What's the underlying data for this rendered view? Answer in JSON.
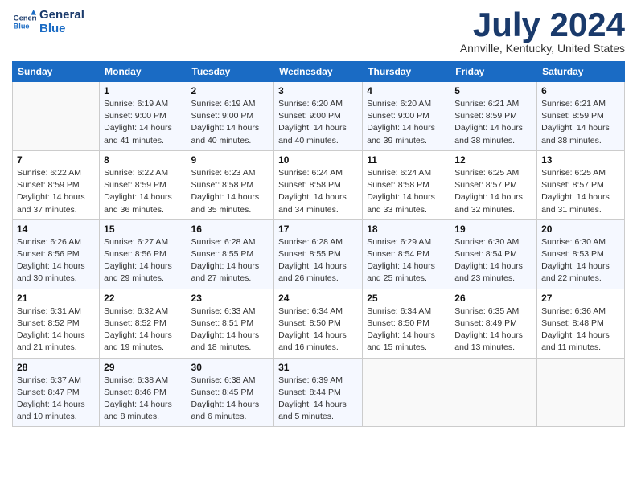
{
  "logo": {
    "line1": "General",
    "line2": "Blue"
  },
  "title": "July 2024",
  "subtitle": "Annville, Kentucky, United States",
  "days_of_week": [
    "Sunday",
    "Monday",
    "Tuesday",
    "Wednesday",
    "Thursday",
    "Friday",
    "Saturday"
  ],
  "weeks": [
    [
      {
        "day": "",
        "info": ""
      },
      {
        "day": "1",
        "info": "Sunrise: 6:19 AM\nSunset: 9:00 PM\nDaylight: 14 hours\nand 41 minutes."
      },
      {
        "day": "2",
        "info": "Sunrise: 6:19 AM\nSunset: 9:00 PM\nDaylight: 14 hours\nand 40 minutes."
      },
      {
        "day": "3",
        "info": "Sunrise: 6:20 AM\nSunset: 9:00 PM\nDaylight: 14 hours\nand 40 minutes."
      },
      {
        "day": "4",
        "info": "Sunrise: 6:20 AM\nSunset: 9:00 PM\nDaylight: 14 hours\nand 39 minutes."
      },
      {
        "day": "5",
        "info": "Sunrise: 6:21 AM\nSunset: 8:59 PM\nDaylight: 14 hours\nand 38 minutes."
      },
      {
        "day": "6",
        "info": "Sunrise: 6:21 AM\nSunset: 8:59 PM\nDaylight: 14 hours\nand 38 minutes."
      }
    ],
    [
      {
        "day": "7",
        "info": "Sunrise: 6:22 AM\nSunset: 8:59 PM\nDaylight: 14 hours\nand 37 minutes."
      },
      {
        "day": "8",
        "info": "Sunrise: 6:22 AM\nSunset: 8:59 PM\nDaylight: 14 hours\nand 36 minutes."
      },
      {
        "day": "9",
        "info": "Sunrise: 6:23 AM\nSunset: 8:58 PM\nDaylight: 14 hours\nand 35 minutes."
      },
      {
        "day": "10",
        "info": "Sunrise: 6:24 AM\nSunset: 8:58 PM\nDaylight: 14 hours\nand 34 minutes."
      },
      {
        "day": "11",
        "info": "Sunrise: 6:24 AM\nSunset: 8:58 PM\nDaylight: 14 hours\nand 33 minutes."
      },
      {
        "day": "12",
        "info": "Sunrise: 6:25 AM\nSunset: 8:57 PM\nDaylight: 14 hours\nand 32 minutes."
      },
      {
        "day": "13",
        "info": "Sunrise: 6:25 AM\nSunset: 8:57 PM\nDaylight: 14 hours\nand 31 minutes."
      }
    ],
    [
      {
        "day": "14",
        "info": "Sunrise: 6:26 AM\nSunset: 8:56 PM\nDaylight: 14 hours\nand 30 minutes."
      },
      {
        "day": "15",
        "info": "Sunrise: 6:27 AM\nSunset: 8:56 PM\nDaylight: 14 hours\nand 29 minutes."
      },
      {
        "day": "16",
        "info": "Sunrise: 6:28 AM\nSunset: 8:55 PM\nDaylight: 14 hours\nand 27 minutes."
      },
      {
        "day": "17",
        "info": "Sunrise: 6:28 AM\nSunset: 8:55 PM\nDaylight: 14 hours\nand 26 minutes."
      },
      {
        "day": "18",
        "info": "Sunrise: 6:29 AM\nSunset: 8:54 PM\nDaylight: 14 hours\nand 25 minutes."
      },
      {
        "day": "19",
        "info": "Sunrise: 6:30 AM\nSunset: 8:54 PM\nDaylight: 14 hours\nand 23 minutes."
      },
      {
        "day": "20",
        "info": "Sunrise: 6:30 AM\nSunset: 8:53 PM\nDaylight: 14 hours\nand 22 minutes."
      }
    ],
    [
      {
        "day": "21",
        "info": "Sunrise: 6:31 AM\nSunset: 8:52 PM\nDaylight: 14 hours\nand 21 minutes."
      },
      {
        "day": "22",
        "info": "Sunrise: 6:32 AM\nSunset: 8:52 PM\nDaylight: 14 hours\nand 19 minutes."
      },
      {
        "day": "23",
        "info": "Sunrise: 6:33 AM\nSunset: 8:51 PM\nDaylight: 14 hours\nand 18 minutes."
      },
      {
        "day": "24",
        "info": "Sunrise: 6:34 AM\nSunset: 8:50 PM\nDaylight: 14 hours\nand 16 minutes."
      },
      {
        "day": "25",
        "info": "Sunrise: 6:34 AM\nSunset: 8:50 PM\nDaylight: 14 hours\nand 15 minutes."
      },
      {
        "day": "26",
        "info": "Sunrise: 6:35 AM\nSunset: 8:49 PM\nDaylight: 14 hours\nand 13 minutes."
      },
      {
        "day": "27",
        "info": "Sunrise: 6:36 AM\nSunset: 8:48 PM\nDaylight: 14 hours\nand 11 minutes."
      }
    ],
    [
      {
        "day": "28",
        "info": "Sunrise: 6:37 AM\nSunset: 8:47 PM\nDaylight: 14 hours\nand 10 minutes."
      },
      {
        "day": "29",
        "info": "Sunrise: 6:38 AM\nSunset: 8:46 PM\nDaylight: 14 hours\nand 8 minutes."
      },
      {
        "day": "30",
        "info": "Sunrise: 6:38 AM\nSunset: 8:45 PM\nDaylight: 14 hours\nand 6 minutes."
      },
      {
        "day": "31",
        "info": "Sunrise: 6:39 AM\nSunset: 8:44 PM\nDaylight: 14 hours\nand 5 minutes."
      },
      {
        "day": "",
        "info": ""
      },
      {
        "day": "",
        "info": ""
      },
      {
        "day": "",
        "info": ""
      }
    ]
  ]
}
